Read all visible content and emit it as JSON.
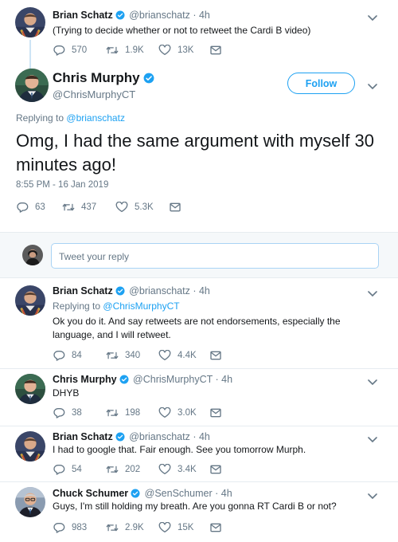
{
  "tweets": [
    {
      "name": "Brian Schatz",
      "handle": "@brianschatz",
      "dot": "·",
      "time": "4h",
      "text": "(Trying to decide whether or not to retweet the Cardi B video)",
      "replies": "570",
      "retweets": "1.9K",
      "likes": "13K"
    },
    {
      "name": "Brian Schatz",
      "handle": "@brianschatz",
      "dot": "·",
      "time": "4h",
      "replying_label": "Replying to",
      "replying_to": "@ChrisMurphyCT",
      "text": "Ok you do it. And say retweets are not endorsements, especially the language, and I will retweet.",
      "replies": "84",
      "retweets": "340",
      "likes": "4.4K"
    },
    {
      "name": "Chris Murphy",
      "handle": "@ChrisMurphyCT",
      "dot": "·",
      "time": "4h",
      "text": "DHYB",
      "replies": "38",
      "retweets": "198",
      "likes": "3.0K"
    },
    {
      "name": "Brian Schatz",
      "handle": "@brianschatz",
      "dot": "·",
      "time": "4h",
      "text": "I had to google that. Fair enough. See you tomorrow Murph.",
      "replies": "54",
      "retweets": "202",
      "likes": "3.4K"
    },
    {
      "name": "Chuck Schumer",
      "handle": "@SenSchumer",
      "dot": "·",
      "time": "4h",
      "text": "Guys, I'm still holding my breath. Are you gonna RT Cardi B or not?",
      "replies": "983",
      "retweets": "2.9K",
      "likes": "15K"
    }
  ],
  "main_tweet": {
    "name": "Chris Murphy",
    "handle": "@ChrisMurphyCT",
    "follow_label": "Follow",
    "replying_label": "Replying to",
    "replying_to": "@brianschatz",
    "text": "Omg, I had the same argument with myself 30 minutes ago!",
    "timestamp": "8:55 PM - 16 Jan 2019",
    "replies": "63",
    "retweets": "437",
    "likes": "5.3K"
  },
  "reply_box": {
    "placeholder": "Tweet your reply"
  },
  "colors": {
    "accent": "#1da1f2",
    "muted": "#657786",
    "separator": "#e6ecf0"
  },
  "icons": [
    "reply-icon",
    "retweet-icon",
    "like-icon",
    "direct-message-icon",
    "verified-icon",
    "chevron-down-icon"
  ]
}
